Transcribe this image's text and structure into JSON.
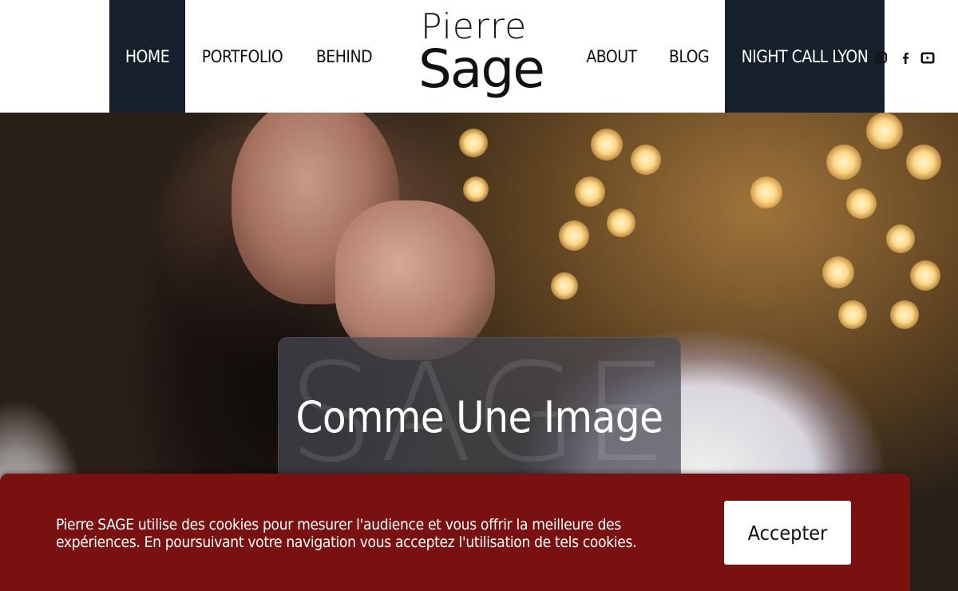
{
  "nav": {
    "left": [
      {
        "label": "HOME",
        "active": true
      },
      {
        "label": "PORTFOLIO"
      },
      {
        "label": "BEHIND"
      }
    ],
    "right": [
      {
        "label": "ABOUT"
      },
      {
        "label": "BLOG"
      },
      {
        "label": "NIGHT CALL LYON",
        "highlighted": true
      }
    ]
  },
  "logo": {
    "line1": "Pierre",
    "line2": "Sage"
  },
  "social": [
    {
      "icon": "instagram-icon"
    },
    {
      "icon": "facebook-icon"
    },
    {
      "icon": "youtube-icon"
    }
  ],
  "hero": {
    "watermark": "SAGE",
    "title": "Comme Une Image"
  },
  "cookie_banner": {
    "text": "Pierre SAGE utilise des cookies pour mesurer l'audience et vous offrir la meilleure des expériences. En poursuivant votre navigation vous acceptez l'utilisation de tels cookies.",
    "accept_label": "Accepter"
  },
  "colors": {
    "nav_dark": "#16202c",
    "cookie_bg": "#7a1111",
    "text_dark": "#111111"
  }
}
